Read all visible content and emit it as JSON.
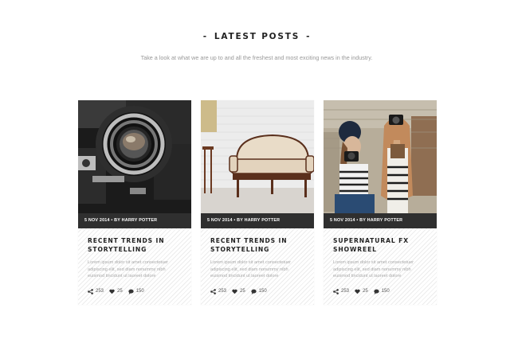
{
  "section": {
    "title": "LATEST POSTS",
    "dash": "-",
    "subtitle": "Take a look at what we are up to and all the freshest and most exciting news in the industry."
  },
  "posts": [
    {
      "image": "vintage-camera-photo",
      "meta": "5 NOV 2014 • BY HARRY POTTER",
      "title": "RECENT TRENDS IN STORYTELLING",
      "excerpt": "Lorem ipsum dolor sit amet consectetuer adipiscing elit, sed diam nonummy nibh euismod tincidunt ut laoreet dolore",
      "shares": "253",
      "likes": "25",
      "comments": "150"
    },
    {
      "image": "vintage-sofa-photo",
      "meta": "5 NOV 2014 • BY HARRY POTTER",
      "title": "RECENT TRENDS IN STORYTELLING",
      "excerpt": "Lorem ipsum dolor sit amet consectetuer adipiscing elit, sed diam nonummy nibh euismod tincidunt ut laoreet dolore",
      "shares": "253",
      "likes": "25",
      "comments": "150"
    },
    {
      "image": "girls-with-cameras-photo",
      "meta": "5 NOV 2014 • BY HARRY POTTER",
      "title": "SUPERNATURAL FX SHOWREEL",
      "excerpt": "Lorem ipsum dolor sit amet consectetuer adipiscing elit, sed diam nonummy nibh euismod tincidunt ut laoreet dolore",
      "shares": "253",
      "likes": "25",
      "comments": "150"
    }
  ]
}
